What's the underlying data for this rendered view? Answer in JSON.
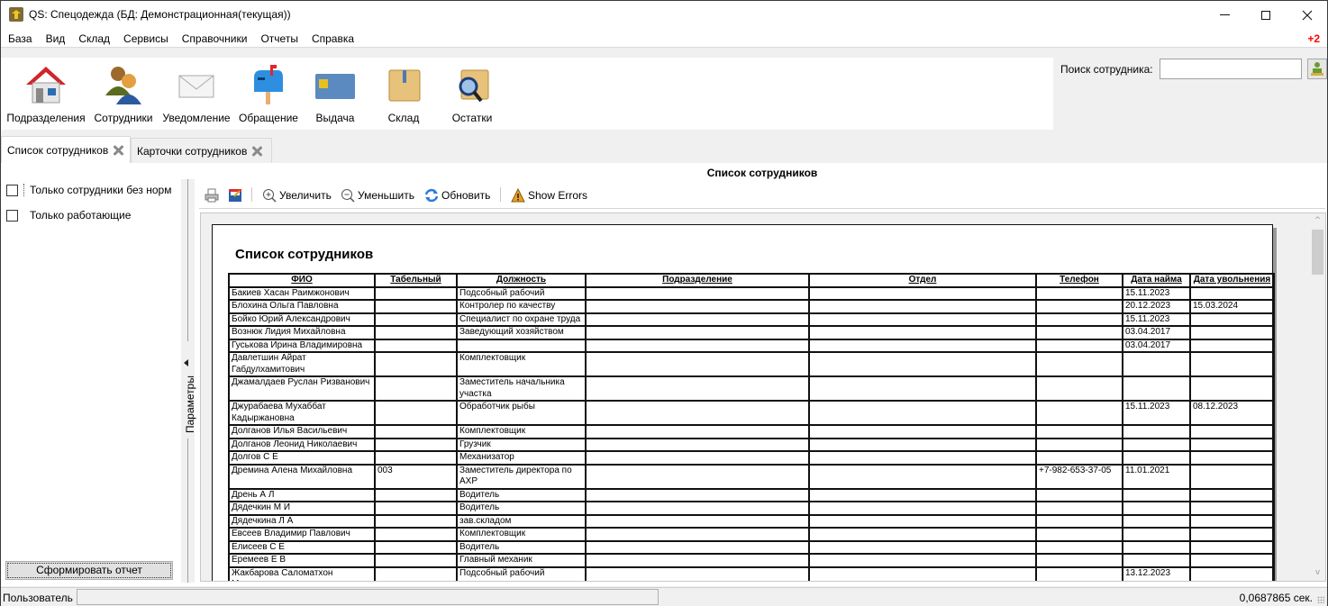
{
  "window": {
    "title": "QS: Спецодежда (БД: Демонстрационная(текущая))",
    "controls": {
      "minimize": "minimize",
      "maximize": "maximize",
      "close": "close"
    }
  },
  "menu": {
    "items": [
      "База",
      "Вид",
      "Склад",
      "Сервисы",
      "Справочники",
      "Отчеты",
      "Справка"
    ],
    "badge": "+2"
  },
  "toolbar": {
    "buttons": [
      {
        "label": "Подразделения",
        "icon": "house-icon"
      },
      {
        "label": "Сотрудники",
        "icon": "users-icon"
      },
      {
        "label": "Уведомление",
        "icon": "envelope-icon"
      },
      {
        "label": "Обращение",
        "icon": "mailbox-icon"
      },
      {
        "label": "Выдача",
        "icon": "card-icon"
      },
      {
        "label": "Склад",
        "icon": "box-icon"
      },
      {
        "label": "Остатки",
        "icon": "box-search-icon"
      }
    ],
    "search_label": "Поиск сотрудника:",
    "search_value": "",
    "search_placeholder": ""
  },
  "tabs": [
    {
      "label": "Список сотрудников",
      "active": true
    },
    {
      "label": "Карточки сотрудников",
      "active": false
    }
  ],
  "params": {
    "checkboxes": [
      {
        "label": "Только сотрудники без норм",
        "checked": false
      },
      {
        "label": "Только работающие",
        "checked": false
      }
    ],
    "panel_label": "Параметры",
    "build_button": "Сформировать отчет"
  },
  "report": {
    "header_title": "Список сотрудников",
    "toolbar": {
      "zoom_in": "Увеличить",
      "zoom_out": "Уменьшить",
      "refresh": "Обновить",
      "show_errors": "Show Errors"
    },
    "page_title": "Список сотрудников",
    "columns": [
      "ФИО",
      "Табельный",
      "Должность",
      "Подразделение",
      "Отдел",
      "Телефон",
      "Дата найма",
      "Дата увольнения"
    ],
    "rows": [
      [
        "Бакиев Хасан Раимжонович",
        "",
        "Подсобный рабочий",
        "",
        "",
        "",
        "15.11.2023",
        ""
      ],
      [
        "Блохина Ольга Павловна",
        "",
        "Контролер по качеству",
        "",
        "",
        "",
        "20.12.2023",
        "15.03.2024"
      ],
      [
        "Бойко Юрий Александрович",
        "",
        "Специалист по охране труда",
        "",
        "",
        "",
        "15.11.2023",
        ""
      ],
      [
        "Вознюк Лидия Михайловна",
        "",
        "Заведующий хозяйством",
        "",
        "",
        "",
        "03.04.2017",
        ""
      ],
      [
        "Гуськова Ирина Владимировна",
        "",
        "",
        "",
        "",
        "",
        "03.04.2017",
        ""
      ],
      [
        "Давлетшин Айрат Габдулхамитович",
        "",
        "Комплектовщик",
        "",
        "",
        "",
        "",
        ""
      ],
      [
        "Джамалдаев Руслан Ризванович",
        "",
        "Заместитель начальника участка",
        "",
        "",
        "",
        "",
        ""
      ],
      [
        "Джурабаева Мухаббат Кадыржановна",
        "",
        "Обработчик рыбы",
        "",
        "",
        "",
        "15.11.2023",
        "08.12.2023"
      ],
      [
        "Долганов Илья Васильевич",
        "",
        "Комплектовщик",
        "",
        "",
        "",
        "",
        ""
      ],
      [
        "Долганов Леонид Николаевич",
        "",
        "Грузчик",
        "",
        "",
        "",
        "",
        ""
      ],
      [
        "Долгов С Е",
        "",
        "Механизатор",
        "",
        "",
        "",
        "",
        ""
      ],
      [
        "Дремина Алена Михайловна",
        "003",
        "Заместитель директора по АХР",
        "",
        "",
        "+7-982-653-37-05",
        "11.01.2021",
        ""
      ],
      [
        "Дрень А Л",
        "",
        "Водитель",
        "",
        "",
        "",
        "",
        ""
      ],
      [
        "Дядечкин М И",
        "",
        "Водитель",
        "",
        "",
        "",
        "",
        ""
      ],
      [
        "Дядечкина Л А",
        "",
        "зав.складом",
        "",
        "",
        "",
        "",
        ""
      ],
      [
        "Евсеев Владимир Павлович",
        "",
        "Комплектовщик",
        "",
        "",
        "",
        "",
        ""
      ],
      [
        "Елисеев С Е",
        "",
        "Водитель",
        "",
        "",
        "",
        "",
        ""
      ],
      [
        "Еремеев Е В",
        "",
        "Главный механик",
        "",
        "",
        "",
        "",
        ""
      ],
      [
        "Жакбарова Саломатхон Мухамедюсуповна",
        "",
        "Подсобный рабочий",
        "",
        "",
        "",
        "13.12.2023",
        ""
      ]
    ]
  },
  "status": {
    "user_label": "Пользователь",
    "user_value": "",
    "elapsed": "0,0687865 сек."
  },
  "colors": {
    "badge": "#ff0000",
    "background": "#f0f0f0"
  }
}
